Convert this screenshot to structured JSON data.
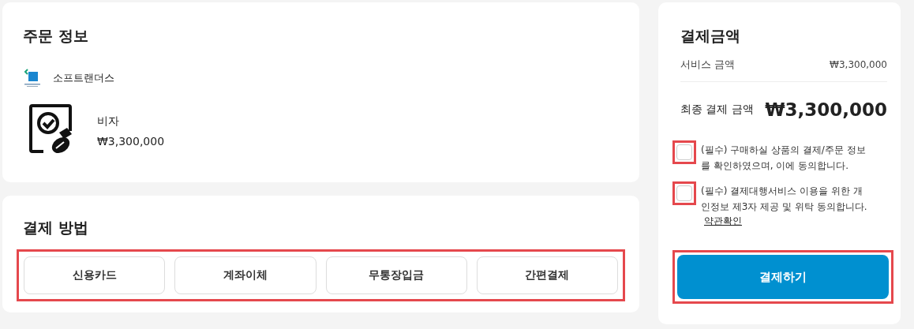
{
  "order_info": {
    "title": "주문 정보",
    "seller": "소프트랜더스",
    "product": {
      "name": "비자",
      "price": "₩3,300,000"
    }
  },
  "payment_method": {
    "title": "결제 방법",
    "highlighted": true,
    "options": [
      {
        "label": "신용카드",
        "selected": false
      },
      {
        "label": "계좌이체",
        "selected": false
      },
      {
        "label": "무통장입금",
        "selected": false
      },
      {
        "label": "간편결제",
        "selected": false
      }
    ]
  },
  "summary": {
    "title": "결제금액",
    "service_label": "서비스 금액",
    "service_amount": "₩3,300,000",
    "final_label": "최종 결제 금액",
    "final_amount": "₩3,300,000",
    "agreements": [
      {
        "text": "(필수) 구매하실 상품의 결제/주문 정보를 확인하였으며, 이에 동의합니다.",
        "checked": false,
        "highlighted": true
      },
      {
        "text": "(필수) 결제대행서비스 이용을 위한 개인정보 제3자 제공 및 위탁 동의합니다.",
        "checked": false,
        "highlighted": true,
        "link": "약관확인"
      }
    ],
    "pay_button": {
      "label": "결제하기",
      "highlighted": true
    }
  }
}
